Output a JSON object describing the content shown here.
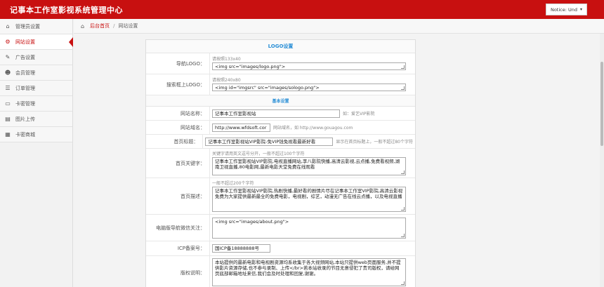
{
  "app_title": "记事本工作室影视系统管理中心",
  "user_menu": {
    "label": "Notice: Und"
  },
  "sidebar": {
    "items": [
      {
        "label": "管理员设置",
        "icon": "home-icon"
      },
      {
        "label": "网站设置",
        "icon": "gears-icon"
      },
      {
        "label": "广告设置",
        "icon": "pin-icon"
      },
      {
        "label": "会员管理",
        "icon": "users-icon"
      },
      {
        "label": "订单管理",
        "icon": "order-list-icon"
      },
      {
        "label": "卡密管理",
        "icon": "card-icon"
      },
      {
        "label": "图片上传",
        "icon": "image-upload-icon"
      },
      {
        "label": "卡密商城",
        "icon": "shop-icon"
      }
    ]
  },
  "breadcrumb": {
    "home": "后台首页",
    "separator": "/",
    "current": "网站设置"
  },
  "form": {
    "logo_section": "LOGO设置",
    "nav_logo": {
      "label": "导航LOGO：",
      "hint": "请按照133x40",
      "value": "<img src=\"images/logo.png\">"
    },
    "search_logo": {
      "label": "搜索框上LOGO：",
      "hint": "请按照240x80",
      "value": "<img id=\"imgsrc\" src=\"images/sologo.png\">"
    },
    "basic_section": "基本设置",
    "site_name": {
      "label": "网站名称：",
      "value": "记事本工作室影视站",
      "hint": "如：爱艺VIP影院"
    },
    "site_domain": {
      "label": "网站域名：",
      "value": "http://www.wfdsoft.cor",
      "hint": "网站域名，如 http://www.gouagou.com"
    },
    "home_title": {
      "label": "首页标题：",
      "value": "记事本工作室影视站VIP影院-免VIP钱免视看最新好看",
      "hint": "显示在首页标题上，一般不超过80个字符"
    },
    "home_keywords": {
      "label": "首页关键字：",
      "hint": "关键字请用英文逗号分开，一般不超过100个字符",
      "value": "记事本工作室影视站VIP影院,电视直播网站,李八影院快播,高清云影视,云点播,免费看视频,湖南卫视直播,80电影网,最新电影天堂免费在线观看"
    },
    "home_desc": {
      "label": "首页描述：",
      "hint": "一般不超过200个字符",
      "value": "记事本工作室影视站VIP影院,热剧快播,最好看的剧情片尽在记事本工作室VIP影院,高清云影视免费为大家提供最新最全的免费电影，电视剧，综艺，动漫无广告在线云点播，以及电视直播"
    },
    "wechat": {
      "label": "电脑版导航微信关注：",
      "value": "<img src=\"images/about.png\">"
    },
    "icp": {
      "label": "ICP备案号：",
      "value": "国ICP备18888888号"
    },
    "copyright": {
      "label": "版权说明：",
      "value": "本站提供的最新电影和电视剧资源均系收集于各大视频网站,本站只提供web页面服务,并不提供影片资源存储,也不参与录制、上传</br>若本站收录的节目无意侵犯了贵司版权，请给网页底部邮箱地址来信,我们会及时处理和回复,谢谢。"
    }
  },
  "colors": {
    "brand": "#c81010",
    "accent_blue": "#2a8fd6"
  }
}
